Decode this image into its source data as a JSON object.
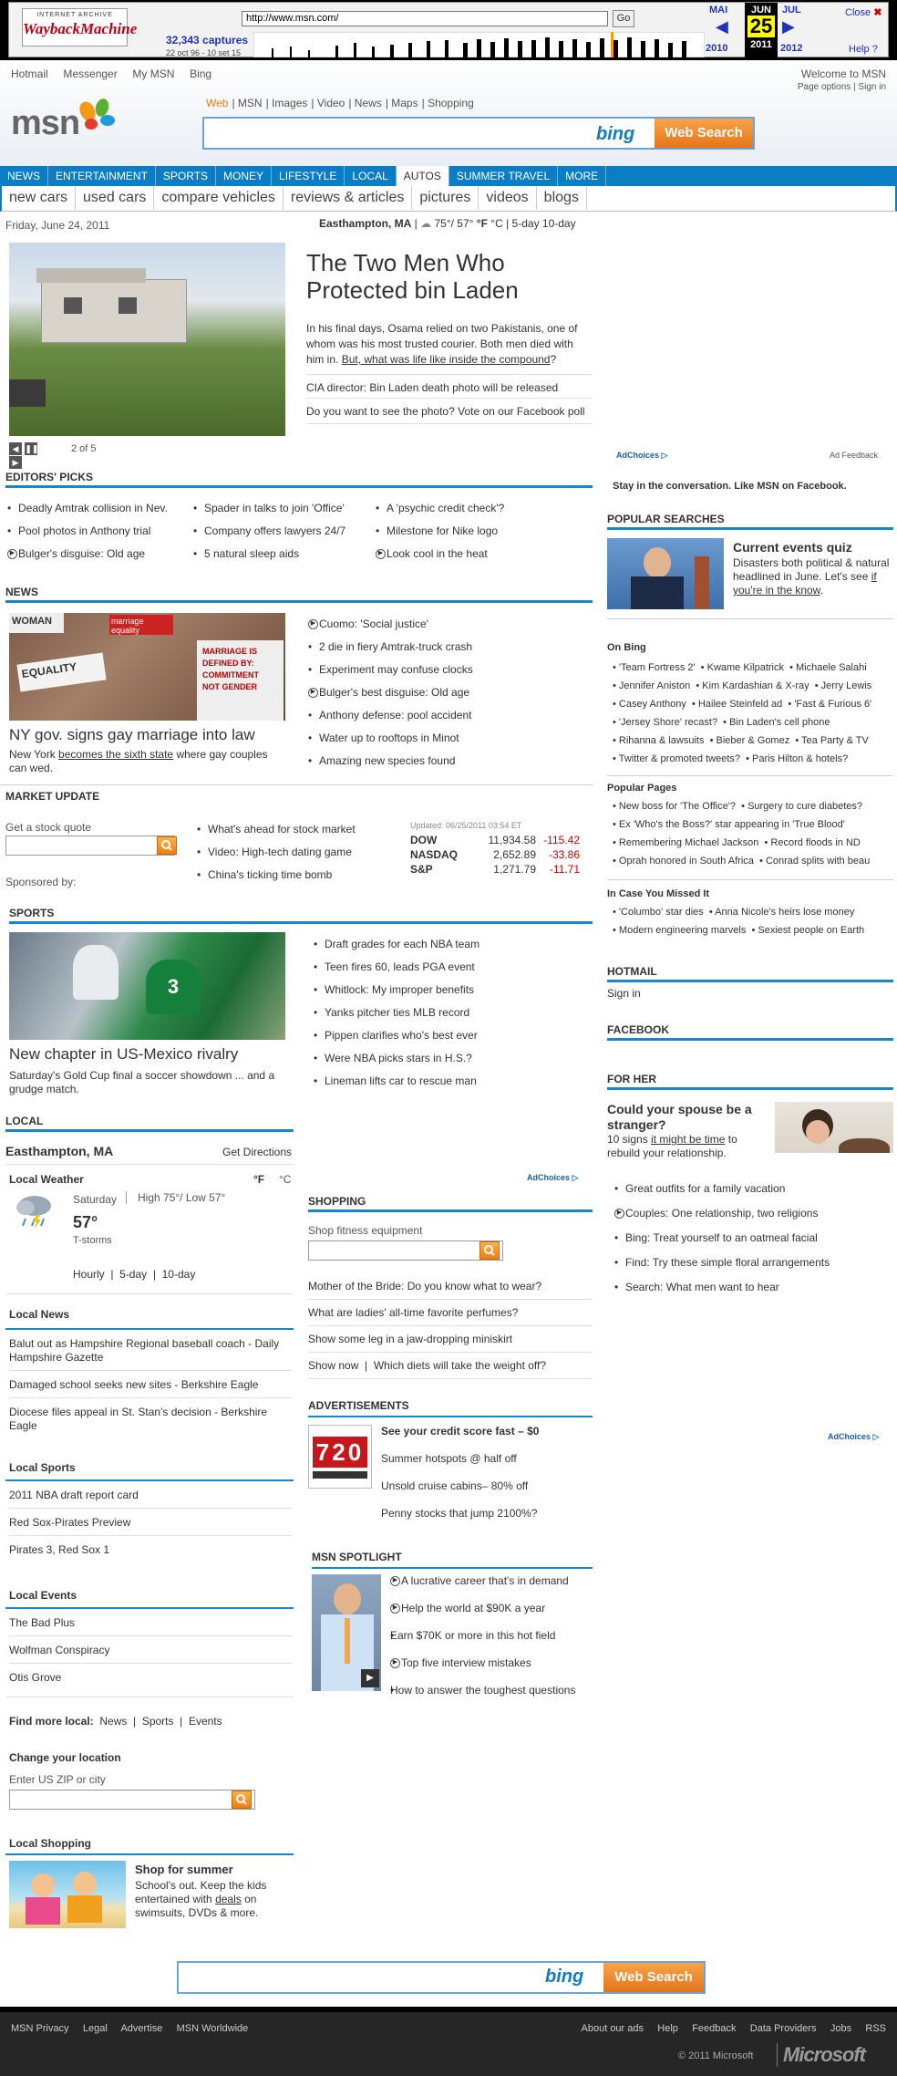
{
  "wayback": {
    "logo_top": "INTERNET ARCHIVE",
    "logo_name": "WaybackMachine",
    "url": "http://www.msn.com/",
    "go": "Go",
    "captures": "32,343 captures",
    "range": "22 oct 96 - 10 set 15",
    "prev_month": "MAI",
    "cur_month": "JUN",
    "next_month": "JUL",
    "day": "25",
    "prev_year": "2010",
    "cur_year": "2011",
    "next_year": "2012",
    "close": "Close",
    "help": "Help"
  },
  "topnav": [
    "Hotmail",
    "Messenger",
    "My MSN",
    "Bing"
  ],
  "welcome": "Welcome to MSN",
  "page_options": "Page options | Sign in",
  "logo": "msn",
  "search_tabs": [
    "Web",
    "MSN",
    "Images",
    "Video",
    "News",
    "Maps",
    "Shopping"
  ],
  "bing": "bing",
  "web_search": "Web Search",
  "nav": [
    "NEWS",
    "ENTERTAINMENT",
    "SPORTS",
    "MONEY",
    "LIFESTYLE",
    "LOCAL",
    "AUTOS",
    "SUMMER TRAVEL",
    "MORE"
  ],
  "subnav": [
    "new cars",
    "used cars",
    "compare vehicles",
    "reviews & articles",
    "pictures",
    "videos",
    "blogs"
  ],
  "date": "Friday, June 24, 2011",
  "weather_bar": {
    "location": "Easthampton, MA",
    "temp": "75°/ 57°",
    "f": "°F",
    "c": "°C",
    "forecast": "5-day 10-day"
  },
  "hero": {
    "title": "The Two Men Who Protected bin Laden",
    "body1": "In his final days, Osama relied on two Pakistanis, one of whom was his most trusted courier. Both men died with him in. ",
    "body_link": "But, what was life like inside the compound",
    "body2": "?",
    "link1": "CIA director: Bin Laden death photo will be released",
    "link2": "Do you want to see the photo? Vote on our Facebook poll",
    "pager": "2 of 5"
  },
  "adchoices": "AdChoices",
  "ad_feedback": "Ad Feedback",
  "editors": {
    "title": "EDITORS' PICKS",
    "col1": [
      "Deadly Amtrak collision in Nev.",
      "Pool photos in Anthony trial",
      "Bulger's disguise: Old age"
    ],
    "col2": [
      "Spader in talks to join 'Office'",
      "Company offers lawyers 24/7",
      "5 natural sleep aids"
    ],
    "col3": [
      "A 'psychic credit check'?",
      "Milestone for Nike logo",
      "Look cool in the heat"
    ]
  },
  "news": {
    "title": "NEWS",
    "headline": "NY gov. signs gay marriage into law",
    "sub1": "New York ",
    "sub_link": "becomes the sixth state",
    "sub2": " where gay couples can wed.",
    "items": [
      "Cuomo: 'Social justice'",
      "2 die in fiery Amtrak-truck crash",
      "Experiment may confuse clocks",
      "Bulger's best disguise: Old age",
      "Anthony defense: pool accident",
      "Water up to rooftops in Minot",
      "Amazing new species found"
    ],
    "photo_signs": [
      "WOMAN",
      "marriage equality",
      "EQUALITY",
      "MARRIAGE IS DEFINED BY: COMMITMENT NOT GENDER"
    ]
  },
  "market": {
    "title": "MARKET UPDATE",
    "quote_label": "Get a stock quote",
    "sponsored": "Sponsored by:",
    "links": [
      "What's ahead for stock market",
      "Video: High-tech dating game",
      "China's ticking time bomb"
    ],
    "updated": "Updated: 06/25/2011 03:54 ET",
    "rows": [
      {
        "name": "DOW",
        "value": "11,934.58",
        "change": "-115.42"
      },
      {
        "name": "NASDAQ",
        "value": "2,652.89",
        "change": "-33.86"
      },
      {
        "name": "S&P",
        "value": "1,271.79",
        "change": "-11.71"
      }
    ]
  },
  "sports": {
    "title": "SPORTS",
    "headline": "New chapter in US-Mexico rivalry",
    "sub": "Saturday's Gold Cup final a soccer showdown ... and a grudge match.",
    "items": [
      "Draft grades for each NBA team",
      "Teen fires 60, leads PGA event",
      "Whitlock: My improper benefits",
      "Yanks pitcher ties MLB record",
      "Pippen clarifies who's best ever",
      "Were NBA picks stars in H.S.?",
      "Lineman lifts car to rescue man"
    ]
  },
  "local": {
    "title": "LOCAL",
    "city": "Easthampton, MA",
    "directions": "Get Directions",
    "weather_title": "Local Weather",
    "f": "°F",
    "c": "°C",
    "day": "Saturday",
    "hilo": "High 75°/ Low 57°",
    "temp": "57°",
    "cond": "T-storms",
    "tabs": [
      "Hourly",
      "5-day",
      "10-day"
    ],
    "news_title": "Local News",
    "news": [
      "Balut out as Hampshire Regional baseball coach - Daily Hampshire Gazette",
      "Damaged school seeks new sites - Berkshire Eagle",
      "Diocese files appeal in St. Stan's decision - Berkshire Eagle"
    ],
    "sports_title": "Local Sports",
    "sports": [
      "2011 NBA draft report card",
      "Red Sox-Pirates Preview",
      "Pirates 3, Red Sox 1"
    ],
    "events_title": "Local Events",
    "events": [
      "The Bad Plus",
      "Wolfman Conspiracy",
      "Otis Grove"
    ],
    "find_more": "Find more local:",
    "find_links": [
      "News",
      "Sports",
      "Events"
    ],
    "change_title": "Change your location",
    "zip_label": "Enter US ZIP or city",
    "shop_title": "Local Shopping",
    "shop_head": "Shop for summer",
    "shop1": "School's out. Keep the kids entertained with ",
    "shop_link": "deals",
    "shop2": " on swimsuits, DVDs & more."
  },
  "shopping": {
    "title": "SHOPPING",
    "label": "Shop fitness equipment",
    "links": [
      "Mother of the Bride: Do you know what to wear?",
      "What are ladies' all-time favorite perfumes?",
      "Show some leg in a jaw-dropping miniskirt"
    ],
    "shop_now": "Show now",
    "last": "Which diets will take the weight off?"
  },
  "ads": {
    "title": "ADVERTISEMENTS",
    "first": "See your credit score fast – $0",
    "items": [
      "Summer hotspots @ half off",
      "Unsold cruise cabins– 80% off",
      "Penny stocks that jump 2100%?"
    ],
    "img_text": "720"
  },
  "spotlight": {
    "title": "MSN SPOTLIGHT",
    "items": [
      "A lucrative career that's in demand",
      "Help the world at $90K a year",
      "Earn $70K or more in this hot field",
      "Top five interview mistakes",
      "How to answer the toughest questions"
    ]
  },
  "right": {
    "fb_line": "Stay in the conversation. Like MSN on Facebook.",
    "popular_title": "POPULAR SEARCHES",
    "quiz_title": "Current events quiz",
    "quiz_body": "Disasters both political & natural headlined in June. Let's see ",
    "quiz_link": "if you're in the know",
    "quiz_end": ".",
    "onbing_title": "On Bing",
    "onbing": [
      [
        "'Team Fortress 2'",
        "Kwame Kilpatrick",
        "Michaele Salahi"
      ],
      [
        "Jennifer Aniston",
        "Kim Kardashian & X-ray",
        "Jerry Lewis"
      ],
      [
        "Casey Anthony",
        "Hailee Steinfeld ad",
        "'Fast & Furious 6'"
      ],
      [
        "'Jersey Shore' recast?",
        "Bin Laden's cell phone"
      ],
      [
        "Rihanna & lawsuits",
        "Bieber & Gomez",
        "Tea Party & TV"
      ],
      [
        "Twitter & promoted tweets?",
        "Paris Hilton & hotels?"
      ]
    ],
    "pop_pages_title": "Popular Pages",
    "pop_pages": [
      [
        "New boss for 'The Office'?",
        "Surgery to cure diabetes?"
      ],
      [
        "Ex 'Who's the Boss?' star appearing in 'True Blood'"
      ],
      [
        "Remembering Michael Jackson",
        "Record floods in ND"
      ],
      [
        "Oprah honored in South Africa",
        "Conrad splits with beau"
      ]
    ],
    "missed_title": "In Case You Missed It",
    "missed": [
      [
        "'Columbo' star dies",
        "Anna Nicole's heirs lose money"
      ],
      [
        "Modern engineering marvels",
        "Sexiest people on Earth"
      ]
    ],
    "hotmail_title": "HOTMAIL",
    "sign_in": "Sign in",
    "facebook_title": "FACEBOOK",
    "forher_title": "FOR HER",
    "forher_head": "Could your spouse be a stranger?",
    "forher1": "10 signs ",
    "forher_link": "it might be time",
    "forher2": " to rebuild your relationship.",
    "forher_items": [
      "Great outfits for a family vacation",
      "Couples: One relationship, two religions",
      "Bing: Treat yourself to an oatmeal facial",
      "Find: Try these simple floral arrangements",
      "Search: What men want to hear"
    ]
  },
  "footer": {
    "links_left": [
      "MSN Privacy",
      "Legal",
      "Advertise",
      "MSN Worldwide"
    ],
    "links_right": [
      "About our ads",
      "Help",
      "Feedback",
      "Data Providers",
      "Jobs",
      "RSS"
    ],
    "copyright": "© 2011 Microsoft",
    "ms_logo": "Microsoft"
  }
}
